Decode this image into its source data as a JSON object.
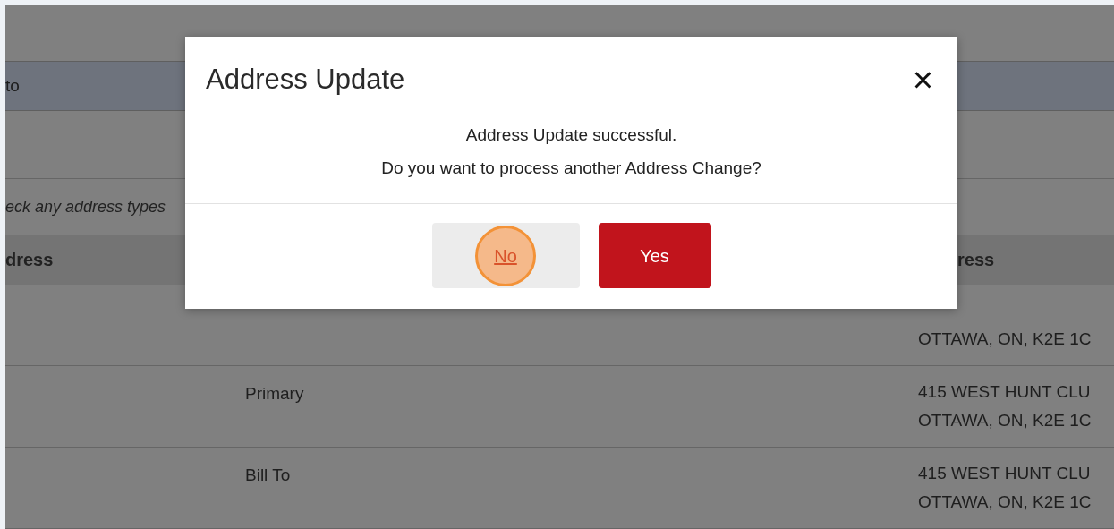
{
  "page": {
    "banner_text": "to",
    "hint": "eck any address types",
    "table": {
      "columns": [
        "dress",
        "ress"
      ],
      "rows": [
        {
          "first_line_hidden": true,
          "address": [
            "OTTAWA, ON, K2E 1C"
          ]
        },
        {
          "type": "Primary",
          "address": [
            "415 WEST HUNT CLU",
            "OTTAWA, ON, K2E 1C"
          ]
        },
        {
          "type": "Bill To",
          "address": [
            "415 WEST HUNT CLU",
            "OTTAWA, ON, K2E 1C"
          ]
        }
      ]
    }
  },
  "dialog": {
    "title": "Address Update",
    "close": "×",
    "message": [
      "Address Update successful.",
      "Do you want to process another Address Change?"
    ],
    "buttons": [
      {
        "label": "No",
        "kind": "secondary",
        "highlighted": true
      },
      {
        "label": "Yes",
        "kind": "primary",
        "highlighted": false
      }
    ]
  }
}
